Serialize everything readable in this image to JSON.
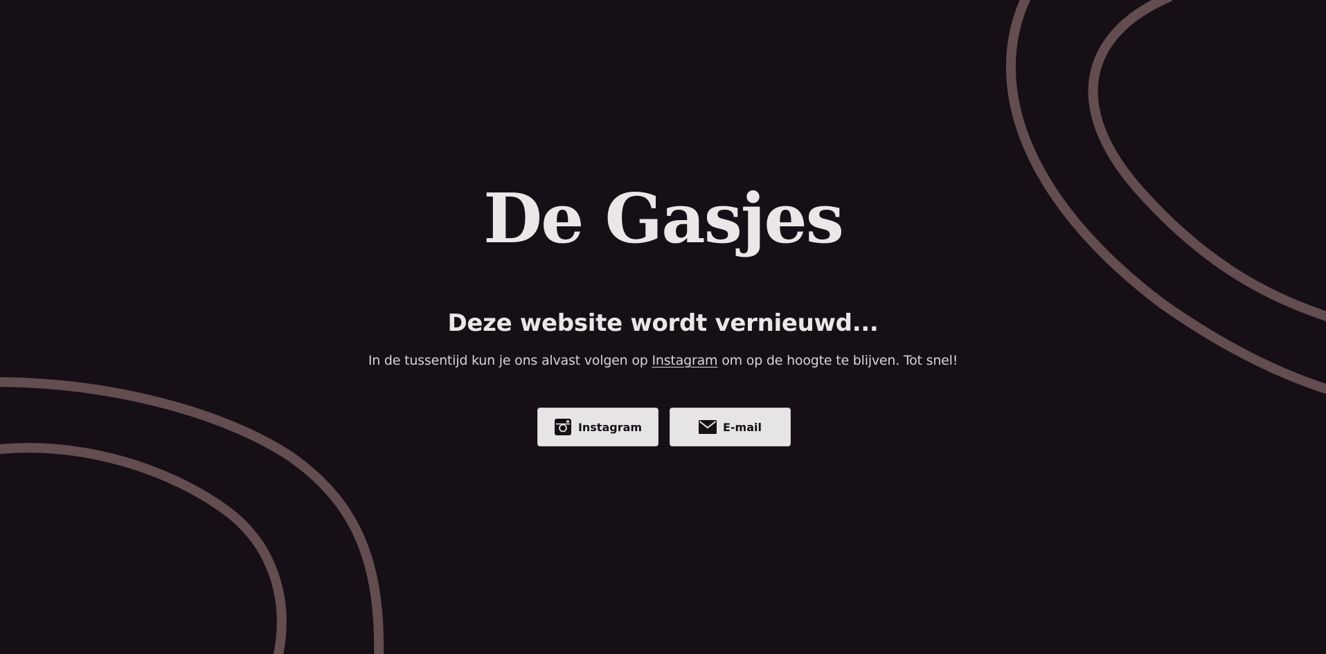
{
  "page": {
    "brand_title": "De Gasjes",
    "headline": "Deze website wordt vernieuwd...",
    "intro_before": "In de tussentijd kun je ons alvast volgen op ",
    "intro_link": "Instagram",
    "intro_after": " om op de hoogte te blijven. Tot snel!"
  },
  "buttons": {
    "instagram_label": "Instagram",
    "instagram_icon": "instagram-icon",
    "email_label": "E-mail",
    "email_icon": "mail-icon"
  },
  "colors": {
    "background": "#161016",
    "text": "#ebe7e8",
    "decor_stroke": "#634d50",
    "button_bg": "#e6e4e5",
    "button_text": "#161016"
  }
}
